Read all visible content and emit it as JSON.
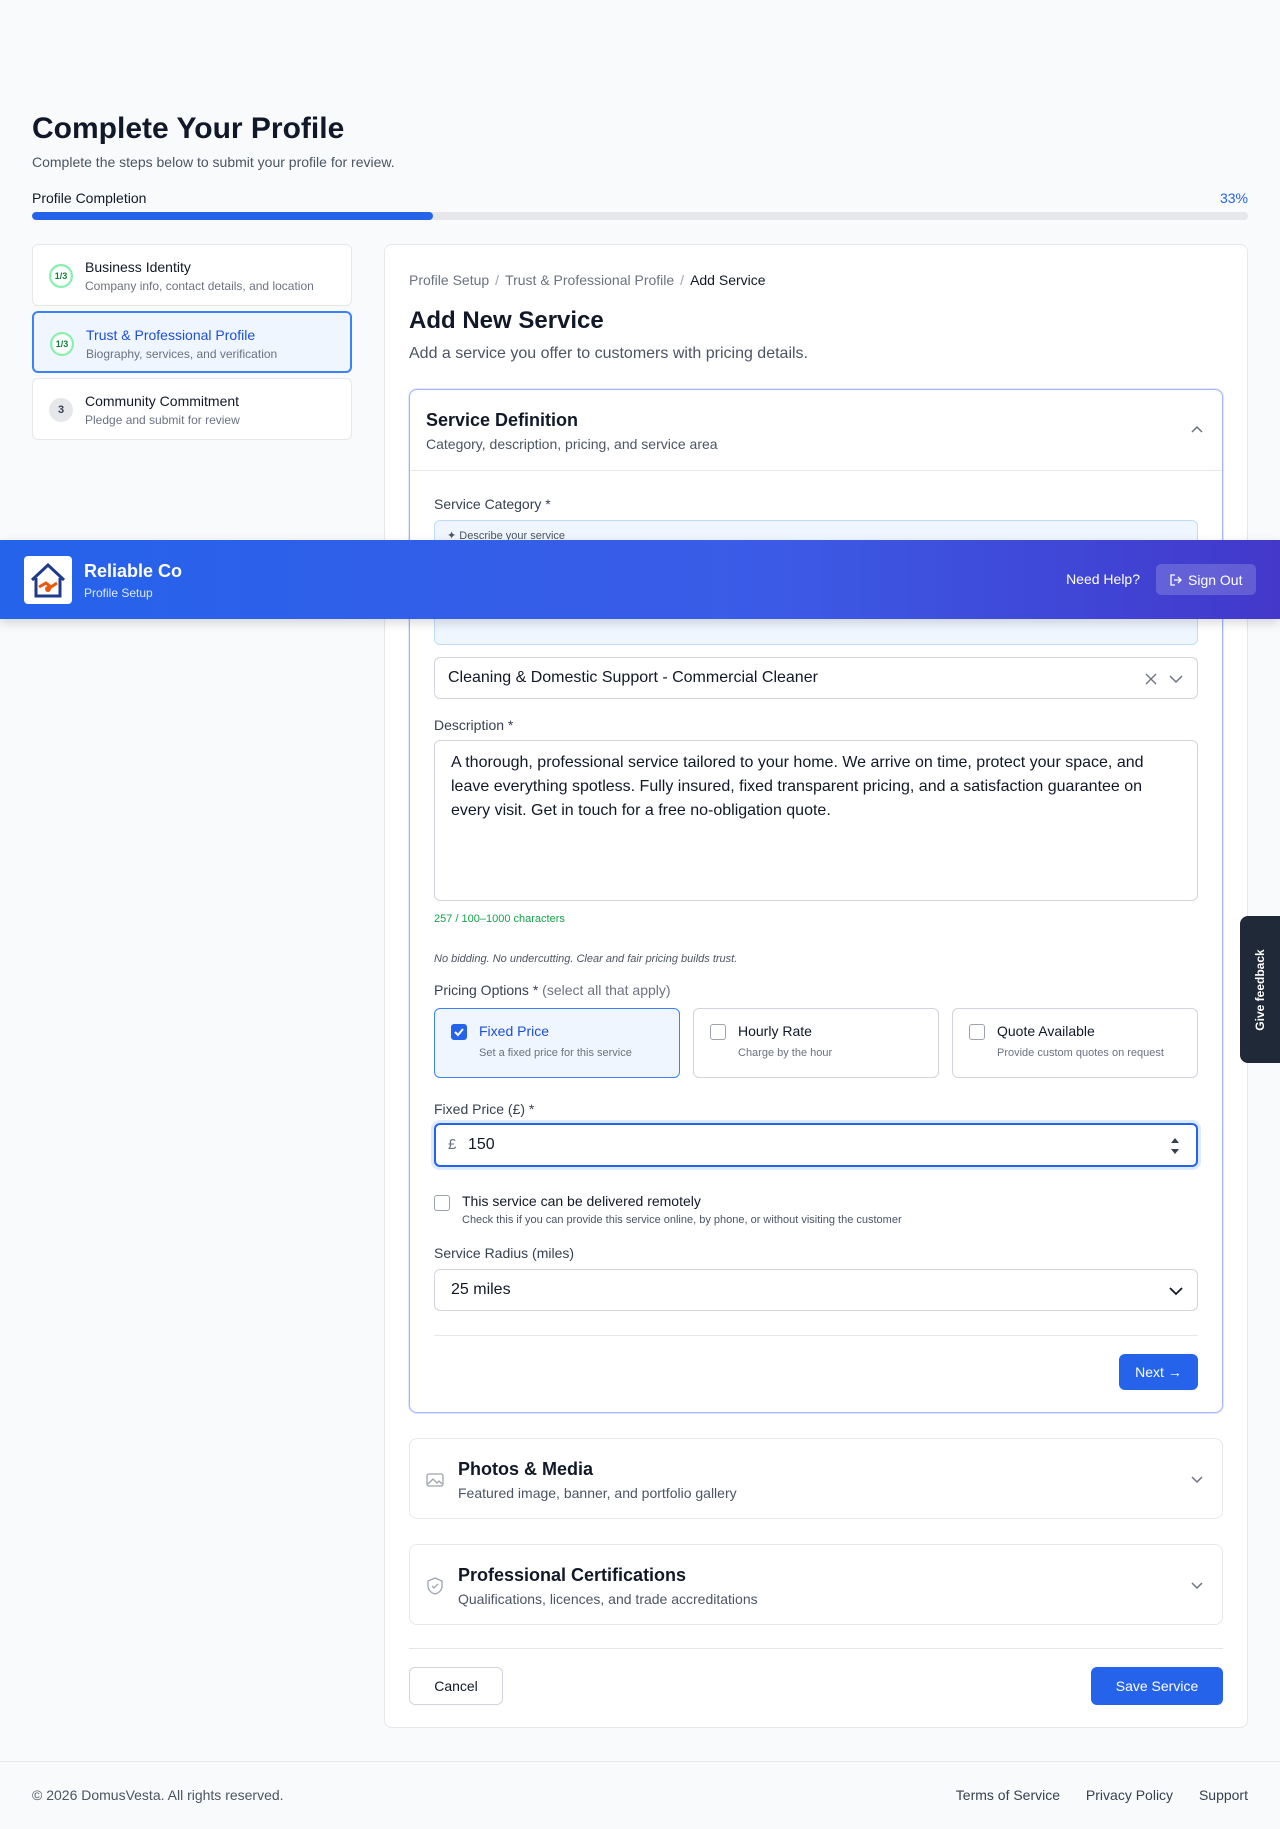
{
  "header": {
    "title": "Complete Your Profile",
    "subtitle": "Complete the steps below to submit your profile for review.",
    "progress_label": "Profile Completion",
    "progress_text": "33%",
    "progress_value": 0.33
  },
  "steps": [
    {
      "badge": "1/3",
      "title": "Business Identity",
      "desc": "Company info, contact details, and location"
    },
    {
      "badge": "1/3",
      "title": "Trust & Professional Profile",
      "desc": "Biography, services, and verification"
    },
    {
      "badge": "3",
      "title": "Community Commitment",
      "desc": "Pledge and submit for review"
    }
  ],
  "breadcrumb": {
    "a": "Profile Setup",
    "b": "Trust & Professional Profile",
    "c": "Add Service",
    "sep": "/"
  },
  "card": {
    "title": "Add New Service",
    "subtitle": "Add a service you offer to customers with pricing details."
  },
  "service_def": {
    "title": "Service Definition",
    "subtitle": "Category, description, pricing, and service area",
    "category_label": "Service Category *",
    "ai_label": "Describe your service",
    "category_value": "Cleaning & Domestic Support - Commercial Cleaner",
    "description_label": "Description *",
    "description_value": "A thorough, professional service tailored to your home. We arrive on time, protect your space, and leave everything spotless. Fully insured, fixed transparent pricing, and a satisfaction guarantee on every visit. Get in touch for a free no-obligation quote.",
    "counter": "257 / 100–1000 characters",
    "note": "No bidding. No undercutting. Clear and fair pricing builds trust.",
    "pricing_label": "Pricing Options *",
    "pricing_hint": "(select all that apply)",
    "options": [
      {
        "title": "Fixed Price",
        "desc": "Set a fixed price for this service",
        "checked": true
      },
      {
        "title": "Hourly Rate",
        "desc": "Charge by the hour",
        "checked": false
      },
      {
        "title": "Quote Available",
        "desc": "Provide custom quotes on request",
        "checked": false
      }
    ],
    "fixed_price_label": "Fixed Price (£) *",
    "currency": "£",
    "fixed_price_value": "150",
    "remote_title": "This service can be delivered remotely",
    "remote_desc": "Check this if you can provide this service online, by phone, or without visiting the customer",
    "radius_label": "Service Radius (miles)",
    "radius_value": "25 miles",
    "next_label": "Next →"
  },
  "photos": {
    "title": "Photos & Media",
    "subtitle": "Featured image, banner, and portfolio gallery"
  },
  "certs": {
    "title": "Professional Certifications",
    "subtitle": "Qualifications, licences, and trade accreditations"
  },
  "actions": {
    "cancel": "Cancel",
    "save": "Save Service"
  },
  "banner": {
    "brand": "Reliable Co",
    "sub": "Profile Setup",
    "help": "Need Help?",
    "signout": "Sign Out"
  },
  "feedback": "Give feedback",
  "footer": {
    "copy": "© 2026 DomusVesta. All rights reserved.",
    "terms": "Terms of Service",
    "privacy": "Privacy Policy",
    "support": "Support"
  },
  "colors": {
    "accent": "#2563eb",
    "success": "#16a34a"
  }
}
